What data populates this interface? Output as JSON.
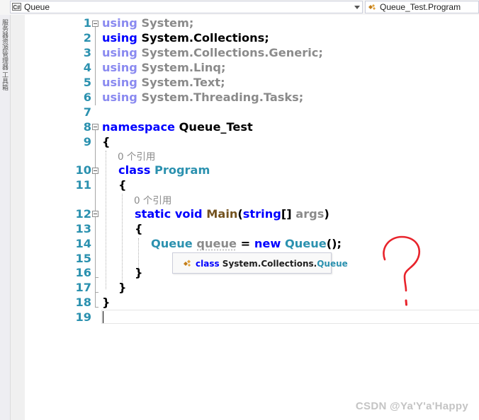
{
  "navbar": {
    "project_combo_icon": "C#",
    "project_combo": "Queue",
    "type_combo": "Queue_Test.Program",
    "type_combo_icon": "class-icon"
  },
  "side_tabs": [
    "服务器资源管理器",
    "工具箱"
  ],
  "editor": {
    "line_numbers": [
      "1",
      "2",
      "3",
      "4",
      "5",
      "6",
      "7",
      "8",
      "9",
      "10",
      "11",
      "12",
      "13",
      "14",
      "15",
      "16",
      "17",
      "18",
      "19"
    ],
    "lines": {
      "l1": {
        "kw": "using",
        "rest": "System;"
      },
      "l2": {
        "kw": "using",
        "rest": "System.Collections;"
      },
      "l3": {
        "kw": "using",
        "rest": "System.Collections.Generic;"
      },
      "l4": {
        "kw": "using",
        "rest": "System.Linq;"
      },
      "l5": {
        "kw": "using",
        "rest": "System.Text;"
      },
      "l6": {
        "kw": "using",
        "rest": "System.Threading.Tasks;"
      },
      "l8": {
        "kw": "namespace",
        "rest": "Queue_Test"
      },
      "l9": {
        "text": "{"
      },
      "l10": {
        "kw": "class",
        "type": "Program"
      },
      "l11": {
        "text": "{"
      },
      "l12": {
        "kw1": "static",
        "kw2": "void",
        "fn": "Main",
        "open": "(",
        "kw3": "string",
        "arr": "[]",
        "param": "args",
        "close": ")"
      },
      "l13": {
        "text": "{"
      },
      "l14": {
        "type1": "Queue",
        "var": "queue",
        "eq": "=",
        "kw": "new",
        "type2": "Queue",
        "end": "();"
      },
      "l16": {
        "text": "}"
      },
      "l17": {
        "text": "}"
      },
      "l18": {
        "text": "}"
      }
    },
    "codelens": [
      "0 个引用",
      "0 个引用"
    ],
    "tooltip": {
      "kw": "class",
      "ns": "System.Collections.",
      "type": "Queue"
    }
  },
  "annotation_mark": "?",
  "watermark": "CSDN @Ya'Y'a'Happy",
  "colors": {
    "keyword": "#0000ff",
    "type": "#2b91af",
    "method": "#74531f",
    "unused": "#8b8b8b",
    "annotation": "#e8232b"
  }
}
